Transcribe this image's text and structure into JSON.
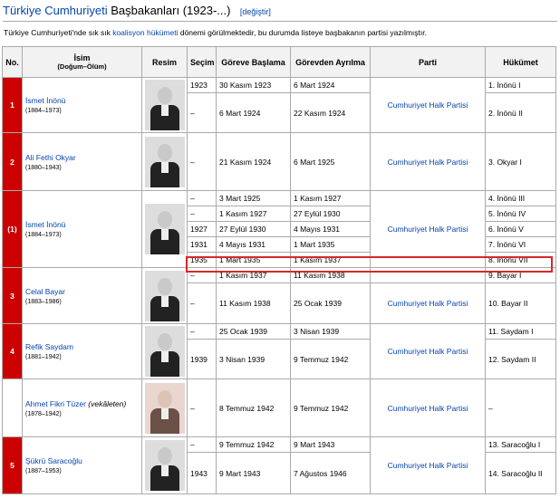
{
  "heading": {
    "link": "Türkiye Cumhuriyeti",
    "rest": " Başbakanları (1923-...)",
    "edit": "[değiştir]"
  },
  "intro": {
    "part1": "Türkiye Cumhuriyeti'nde sık sık ",
    "link": "koalisyon hükümeti",
    "part2": " dönemi görülmektedir, bu durumda listeye başbakanın partisi yazılmıştır."
  },
  "headers": {
    "no": "No.",
    "name": "İsim",
    "name_sub": "(Doğum–Ölüm)",
    "photo": "Resim",
    "election": "Seçim",
    "start": "Göreve Başlama",
    "end": "Görevden Ayrılma",
    "party": "Parti",
    "gov": "Hükümet"
  },
  "groups": [
    {
      "no": "1",
      "name": "İsmet İnönü",
      "years": "(1884–1973)",
      "party": "Cumhuriyet Halk Partisi",
      "photo": "ismet-inonu-photo",
      "terms": [
        {
          "election": "1923",
          "start": "30 Kasım 1923",
          "end": "6 Mart 1924",
          "gov": "1. İnönü I"
        },
        {
          "election": "–",
          "start": "6 Mart 1924",
          "end": "22 Kasım 1924",
          "gov": "2. İnönü II"
        }
      ]
    },
    {
      "no": "2",
      "name": "Ali Fethi Okyar",
      "years": "(1880–1943)",
      "party": "Cumhuriyet Halk Partisi",
      "photo": "ali-fethi-okyar-photo",
      "terms": [
        {
          "election": "–",
          "start": "21 Kasım 1924",
          "end": "6 Mart 1925",
          "gov": "3. Okyar I"
        }
      ]
    },
    {
      "no": "(1)",
      "name": "İsmet İnönü",
      "years": "(1884–1973)",
      "party": "Cumhuriyet Halk Partisi",
      "photo": "ismet-inonu-photo-2",
      "terms": [
        {
          "election": "–",
          "start": "3 Mart 1925",
          "end": "1 Kasım 1927",
          "gov": "4. İnönü III"
        },
        {
          "election": "–",
          "start": "1 Kasım 1927",
          "end": "27 Eylül 1930",
          "gov": "5. İnönü IV"
        },
        {
          "election": "1927",
          "start": "27 Eylül 1930",
          "end": "4 Mayıs 1931",
          "gov": "6. İnönü V"
        },
        {
          "election": "1931",
          "start": "4 Mayıs 1931",
          "end": "1 Mart 1935",
          "gov": "7. İnönü VI"
        },
        {
          "election": "1935",
          "start": "1 Mart 1935",
          "end": "1 Kasım 1937",
          "gov": "8. İnönü VII"
        }
      ]
    },
    {
      "no": "3",
      "name": "Celal Bayar",
      "years": "(1883–1986)",
      "party": "Cumhuriyet Halk Partisi",
      "photo": "celal-bayar-photo",
      "terms": [
        {
          "election": "–",
          "start": "1 Kasım 1937",
          "end": "11 Kasım 1938",
          "gov": "9. Bayar I"
        },
        {
          "election": "–",
          "start": "11 Kasım 1938",
          "end": "25 Ocak 1939",
          "gov": "10. Bayar II"
        }
      ]
    },
    {
      "no": "4",
      "name": "Refik Saydam",
      "years": "(1881–1942)",
      "party": "Cumhuriyet Halk Partisi",
      "photo": "refik-saydam-photo",
      "terms": [
        {
          "election": "–",
          "start": "25 Ocak 1939",
          "end": "3 Nisan 1939",
          "gov": "11. Saydam I"
        },
        {
          "election": "1939",
          "start": "3 Nisan 1939",
          "end": "9 Temmuz 1942",
          "gov": "12. Saydam II"
        }
      ]
    },
    {
      "no": "",
      "name": "Ahmet Fikri Tüzer",
      "name_suffix": " (vekâleten)",
      "years": "(1878–1942)",
      "party": "Cumhuriyet Halk Partisi",
      "photo": "ahmet-fikri-tuzer-photo",
      "terms": [
        {
          "election": "–",
          "start": "8 Temmuz 1942",
          "end": "9 Temmuz 1942",
          "gov": "–"
        }
      ]
    },
    {
      "no": "5",
      "name": "Şükrü Saracoğlu",
      "years": "(1887–1953)",
      "party": "Cumhuriyet Halk Partisi",
      "photo": "sukru-saracoglu-photo",
      "terms": [
        {
          "election": "–",
          "start": "9 Temmuz 1942",
          "end": "9 Mart 1943",
          "gov": "13. Saracoğlu I"
        },
        {
          "election": "1943",
          "start": "9 Mart 1943",
          "end": "7 Ağustos 1946",
          "gov": "14. Saracoğlu II"
        }
      ]
    }
  ]
}
